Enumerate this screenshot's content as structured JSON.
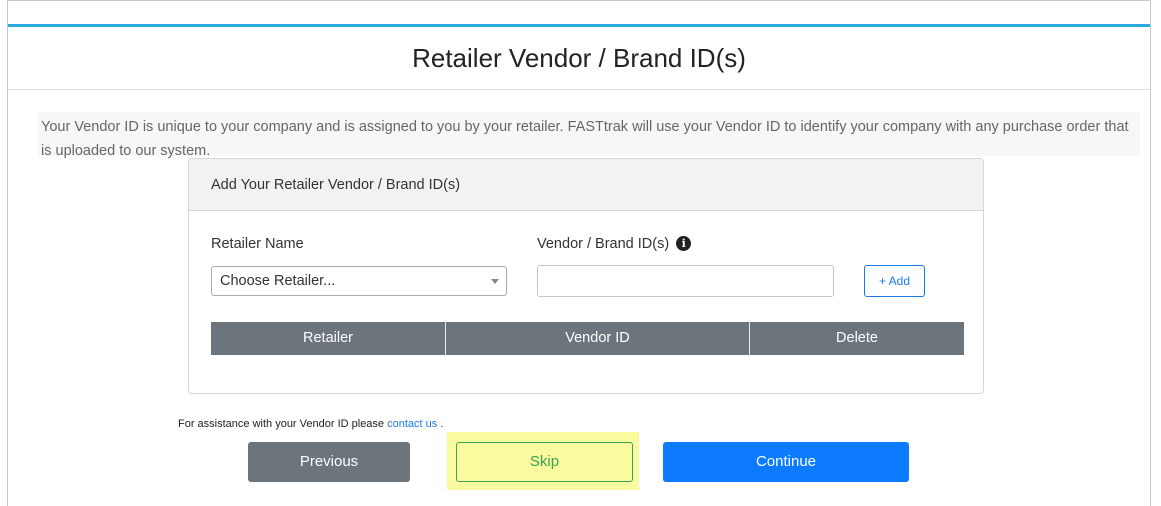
{
  "page": {
    "title": "Retailer Vendor / Brand ID(s)",
    "intro": "Your Vendor ID is unique to your company and is assigned to you by your retailer. FASTtrak will use your Vendor ID to identify your company with any purchase order that is uploaded to our system."
  },
  "card": {
    "header": "Add Your Retailer Vendor / Brand ID(s)",
    "retailer_label": "Retailer Name",
    "retailer_select_value": "Choose Retailer...",
    "vendor_label": "Vendor / Brand ID(s)",
    "vendor_input_value": "",
    "info_glyph": "i",
    "add_button": "+ Add",
    "table_headers": [
      "Retailer",
      "Vendor ID",
      "Delete"
    ]
  },
  "assist": {
    "text": "For assistance with your Vendor ID please",
    "link": "contact us",
    "trailing": "."
  },
  "buttons": {
    "previous": "Previous",
    "skip": "Skip",
    "continue": "Continue"
  },
  "colors": {
    "accent_line": "#2aa9e0",
    "primary": "#0d7bff",
    "secondary": "#6c747c",
    "success_outline": "#3aa356",
    "highlight": "#fafa9e"
  },
  "icons": {
    "info": "info-circle-icon",
    "select_caret": "chevron-down-icon"
  }
}
